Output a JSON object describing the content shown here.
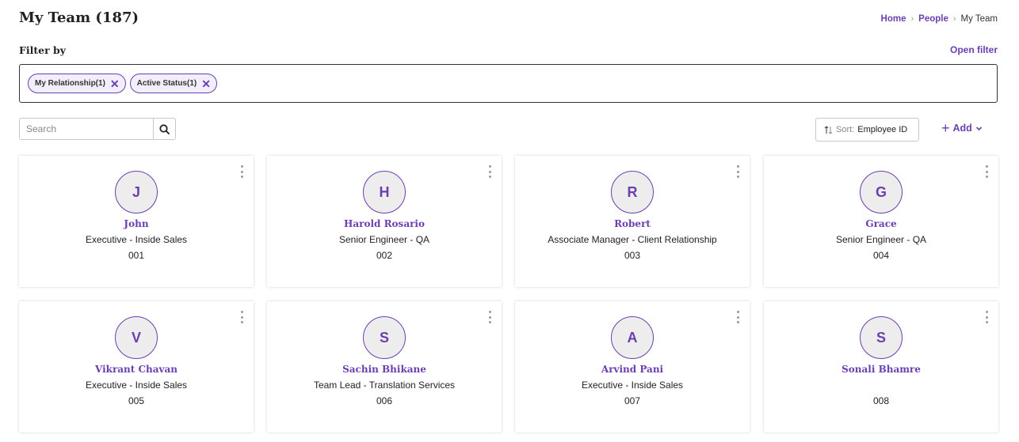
{
  "header": {
    "title": "My Team (187)",
    "breadcrumb": {
      "home": "Home",
      "people": "People",
      "current": "My Team",
      "separator": "›"
    }
  },
  "filter": {
    "label": "Filter by",
    "open_filter": "Open filter",
    "chips": [
      {
        "label": "My Relationship(1)",
        "remove": "✕"
      },
      {
        "label": "Active Status(1)",
        "remove": "✕"
      }
    ]
  },
  "toolbar": {
    "search_placeholder": "Search",
    "sort_label": "Sort:",
    "sort_value": "Employee ID",
    "add_label": "Add",
    "add_plus": "+",
    "add_chevron": "⌄"
  },
  "employees": [
    {
      "initial": "J",
      "name": "John",
      "role": "Executive - Inside Sales",
      "id": "001"
    },
    {
      "initial": "H",
      "name": "Harold Rosario",
      "role": "Senior Engineer - QA",
      "id": "002"
    },
    {
      "initial": "R",
      "name": "Robert",
      "role": "Associate Manager - Client Relationship",
      "id": "003"
    },
    {
      "initial": "G",
      "name": "Grace",
      "role": "Senior Engineer - QA",
      "id": "004"
    },
    {
      "initial": "V",
      "name": "Vikrant Chavan",
      "role": "Executive - Inside Sales",
      "id": "005"
    },
    {
      "initial": "S",
      "name": "Sachin Bhikane",
      "role": "Team Lead - Translation Services",
      "id": "006"
    },
    {
      "initial": "A",
      "name": "Arvind Pani",
      "role": "Executive - Inside Sales",
      "id": "007"
    },
    {
      "initial": "S",
      "name": "Sonali Bhamre",
      "role": "",
      "id": "008"
    }
  ],
  "colors": {
    "accent": "#6a3fb0",
    "chip_bg": "#f3eefb",
    "avatar_bg": "#ededed"
  }
}
